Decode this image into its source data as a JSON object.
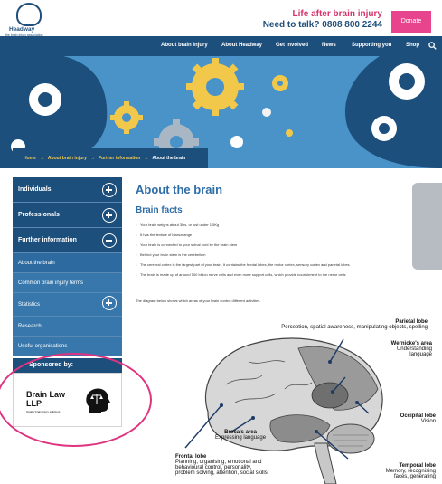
{
  "header": {
    "logo_text": "Headway",
    "logo_sub": "the brain injury association",
    "tagline": "Life after brain injury",
    "helpline": "Need to talk? 0808 800 2244",
    "donate_label": "Donate"
  },
  "nav": {
    "items": [
      "About brain injury",
      "About Headway",
      "Get involved",
      "News",
      "Supporting you",
      "Shop"
    ]
  },
  "breadcrumb": {
    "items": [
      "Home",
      "About brain injury",
      "Further information",
      "About the brain"
    ]
  },
  "sidebar": {
    "items": [
      {
        "label": "Individuals"
      },
      {
        "label": "Professionals"
      },
      {
        "label": "Further information"
      }
    ],
    "sub_items": [
      {
        "label": "About the brain"
      },
      {
        "label": "Common brain injury terms"
      },
      {
        "label": "Statistics"
      },
      {
        "label": "Research"
      },
      {
        "label": "Useful organisations"
      }
    ]
  },
  "sponsor": {
    "heading": "Sponsored by:",
    "name_line1": "Brain Law",
    "name_line2": "LLP",
    "tagline": "Quality brain injury solicitors"
  },
  "main": {
    "title": "About the brain",
    "subtitle": "Brain facts",
    "facts": [
      "Your brain weighs about 3lbs, or just under 1.5Kg",
      "It has the texture of blancmange",
      "Your brain is connected to your spinal cord by the brain stem",
      "Behind your brain stem is the cerebellum",
      "The cerebral cortex is the largest part of your brain. It contains the frontal lobes, the motor cortex, sensory cortex and parietal lobes",
      "The brain is made up of around 100 billion nerve cells and even more support cells, which provide nourishment to the nerve cells"
    ],
    "diagram_intro": "The diagram below shows which areas of your brain control different activities."
  },
  "diagram": {
    "parietal_title": "Parietal lobe",
    "parietal_desc": "Perception, spatial awareness, manipulating objects, spelling",
    "wernicke_title": "Wernicke's area",
    "wernicke_desc1": "Understanding",
    "wernicke_desc2": "language",
    "broca_title": "Broca's area",
    "broca_desc": "Expressing language",
    "occipital_title": "Occipital lobe",
    "occipital_desc": "Vision",
    "temporal_title": "Temporal lobe",
    "temporal_desc1": "Memory, recognising",
    "temporal_desc2": "faces, generating",
    "frontal_title": "Frontal lobe",
    "frontal_desc1": "Planning, organising, emotional and",
    "frontal_desc2": "behavioural control, personality,",
    "frontal_desc3": "problem solving, attention, social skills"
  },
  "colors": {
    "brand_blue": "#1d4f7c",
    "accent_pink": "#e8448e",
    "heading_blue": "#2f6da7",
    "crumb_yellow": "#f2c84b"
  }
}
